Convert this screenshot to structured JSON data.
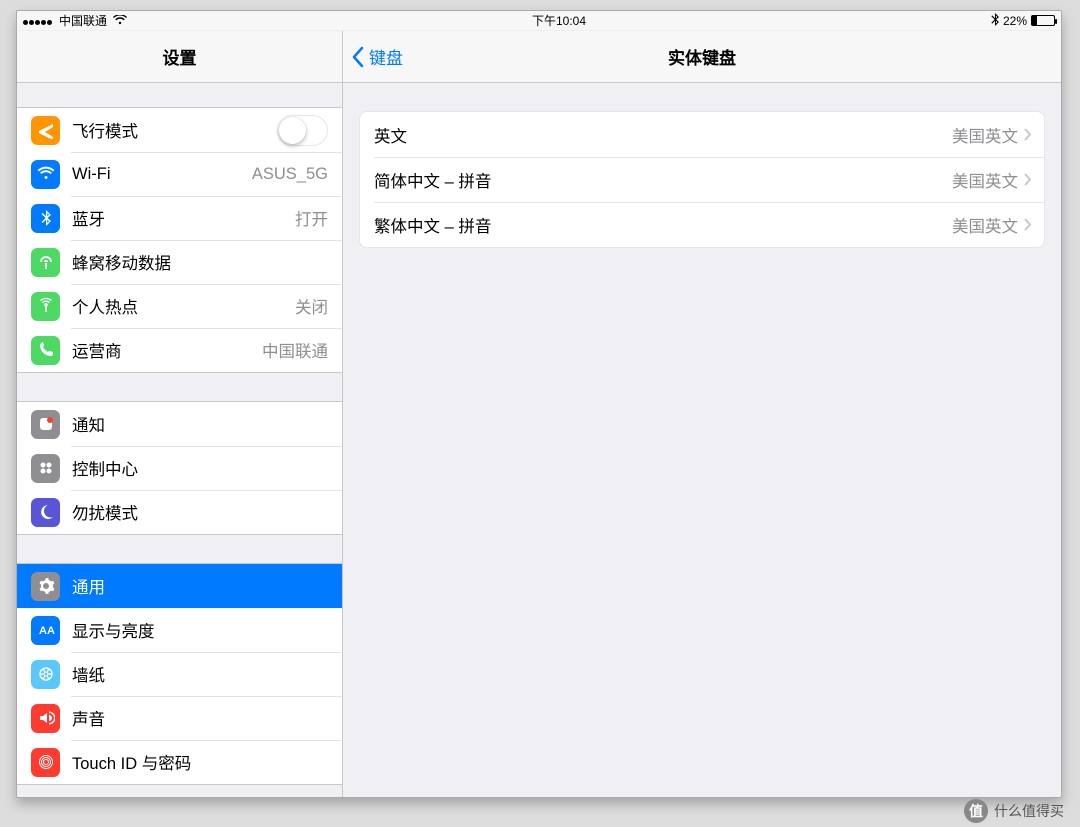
{
  "status": {
    "carrier": "中国联通",
    "time": "下午10:04",
    "battery_text": "22%"
  },
  "sidebar": {
    "title": "设置",
    "groups": [
      [
        {
          "id": "airplane",
          "label": "飞行模式",
          "value": "",
          "type": "toggle",
          "icon": "airplane",
          "color": "#ff9500"
        },
        {
          "id": "wifi",
          "label": "Wi-Fi",
          "value": "ASUS_5G",
          "icon": "wifi",
          "color": "#007aff"
        },
        {
          "id": "bluetooth",
          "label": "蓝牙",
          "value": "打开",
          "icon": "bluetooth",
          "color": "#007aff"
        },
        {
          "id": "cellular",
          "label": "蜂窝移动数据",
          "value": "",
          "icon": "cellular",
          "color": "#4cd964"
        },
        {
          "id": "hotspot",
          "label": "个人热点",
          "value": "关闭",
          "icon": "hotspot",
          "color": "#4cd964"
        },
        {
          "id": "carrier",
          "label": "运营商",
          "value": "中国联通",
          "icon": "phone",
          "color": "#4cd964"
        }
      ],
      [
        {
          "id": "notifications",
          "label": "通知",
          "value": "",
          "icon": "notif",
          "color": "#8e8e93"
        },
        {
          "id": "controlcenter",
          "label": "控制中心",
          "value": "",
          "icon": "cc",
          "color": "#8e8e93"
        },
        {
          "id": "dnd",
          "label": "勿扰模式",
          "value": "",
          "icon": "moon",
          "color": "#5856d6"
        }
      ],
      [
        {
          "id": "general",
          "label": "通用",
          "value": "",
          "icon": "gear",
          "color": "#8e8e93",
          "selected": true
        },
        {
          "id": "display",
          "label": "显示与亮度",
          "value": "",
          "icon": "display",
          "color": "#007aff"
        },
        {
          "id": "wallpaper",
          "label": "墙纸",
          "value": "",
          "icon": "wallpaper",
          "color": "#5ac8fa"
        },
        {
          "id": "sound",
          "label": "声音",
          "value": "",
          "icon": "sound",
          "color": "#ff3b30"
        },
        {
          "id": "touchid",
          "label": "Touch ID 与密码",
          "value": "",
          "icon": "touchid",
          "color": "#ff3b30"
        }
      ]
    ]
  },
  "detail": {
    "back": "键盘",
    "title": "实体键盘",
    "items": [
      {
        "label": "英文",
        "value": "美国英文"
      },
      {
        "label": "简体中文 – 拼音",
        "value": "美国英文"
      },
      {
        "label": "繁体中文 – 拼音",
        "value": "美国英文"
      }
    ]
  },
  "watermark": {
    "badge": "值",
    "text": "什么值得买"
  }
}
